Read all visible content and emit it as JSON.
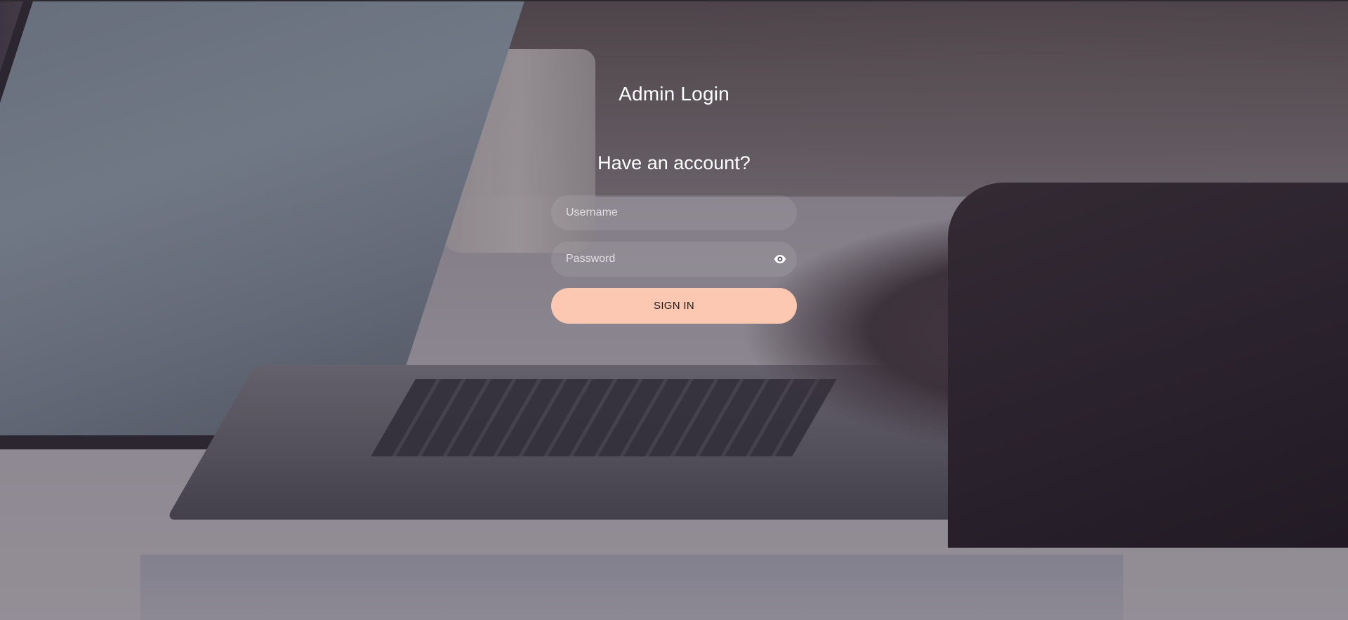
{
  "page": {
    "title": "Admin Login",
    "subtitle": "Have an account?"
  },
  "form": {
    "username": {
      "value": "",
      "placeholder": "Username"
    },
    "password": {
      "value": "",
      "placeholder": "Password",
      "toggle_icon": "eye-icon"
    },
    "submit_label": "SIGN IN"
  },
  "colors": {
    "accent_button": "#fcc8b2",
    "text": "#ffffff",
    "overlay_tint": "#281e2d"
  },
  "background": {
    "subject": "laptop-with-hands-typing"
  }
}
